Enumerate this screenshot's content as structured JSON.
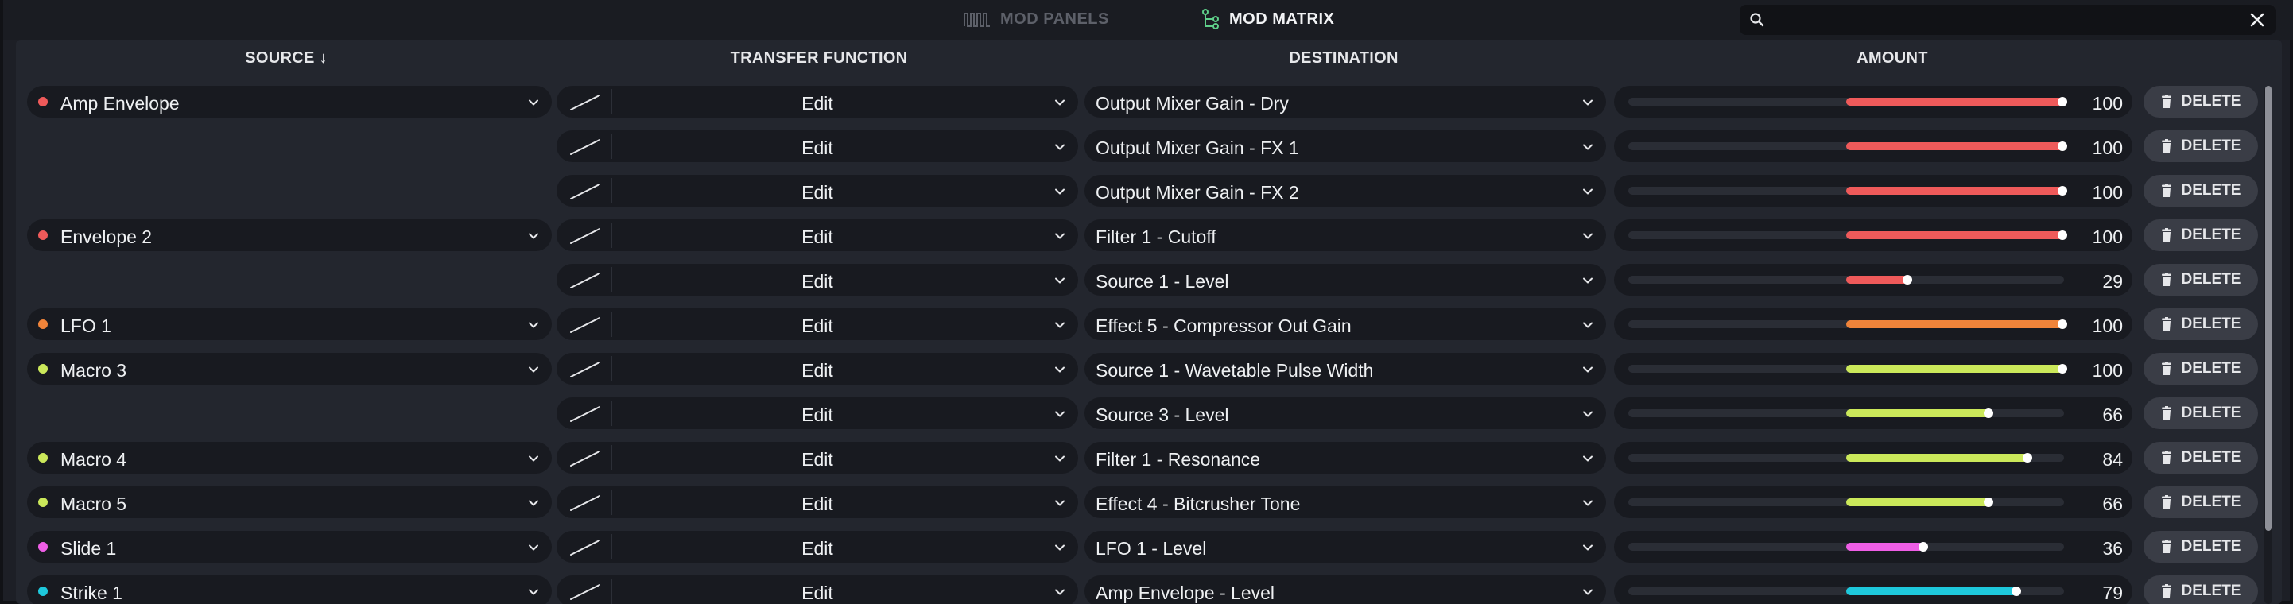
{
  "tabs": [
    {
      "label": "MOD PANELS",
      "icon": "waveform-icon",
      "active": false
    },
    {
      "label": "MOD MATRIX",
      "icon": "matrix-routing-icon",
      "active": true
    }
  ],
  "search": {
    "value": "",
    "placeholder": ""
  },
  "headers": {
    "source": "SOURCE ↓",
    "transfer": "TRANSFER FUNCTION",
    "destination": "DESTINATION",
    "amount": "AMOUNT"
  },
  "delete_label": "DELETE",
  "rows": [
    {
      "source": "Amp Envelope",
      "color": "#ef5a5a",
      "transfer": "Edit",
      "destination": "Output Mixer Gain - Dry",
      "amount": "100"
    },
    {
      "source": "",
      "color": "#ef5a5a",
      "transfer": "Edit",
      "destination": "Output Mixer Gain - FX 1",
      "amount": "100"
    },
    {
      "source": "",
      "color": "#ef5a5a",
      "transfer": "Edit",
      "destination": "Output Mixer Gain - FX 2",
      "amount": "100"
    },
    {
      "source": "Envelope 2",
      "color": "#ef5a5a",
      "transfer": "Edit",
      "destination": "Filter 1 - Cutoff",
      "amount": "100"
    },
    {
      "source": "",
      "color": "#ef5a5a",
      "transfer": "Edit",
      "destination": "Source 1 - Level",
      "amount": "29"
    },
    {
      "source": "LFO 1",
      "color": "#f0843a",
      "transfer": "Edit",
      "destination": "Effect 5 - Compressor Out Gain",
      "amount": "100"
    },
    {
      "source": "Macro 3",
      "color": "#cbe85a",
      "transfer": "Edit",
      "destination": "Source 1 - Wavetable Pulse Width",
      "amount": "100"
    },
    {
      "source": "",
      "color": "#cbe85a",
      "transfer": "Edit",
      "destination": "Source 3 - Level",
      "amount": "66"
    },
    {
      "source": "Macro 4",
      "color": "#cbe85a",
      "transfer": "Edit",
      "destination": "Filter 1 - Resonance",
      "amount": "84"
    },
    {
      "source": "Macro 5",
      "color": "#cbe85a",
      "transfer": "Edit",
      "destination": "Effect 4 - Bitcrusher Tone",
      "amount": "66"
    },
    {
      "source": "Slide 1",
      "color": "#ef5ee6",
      "transfer": "Edit",
      "destination": "LFO 1 - Level",
      "amount": "36"
    },
    {
      "source": "Strike 1",
      "color": "#1ec8dc",
      "transfer": "Edit",
      "destination": "Amp Envelope - Level",
      "amount": "79"
    }
  ]
}
